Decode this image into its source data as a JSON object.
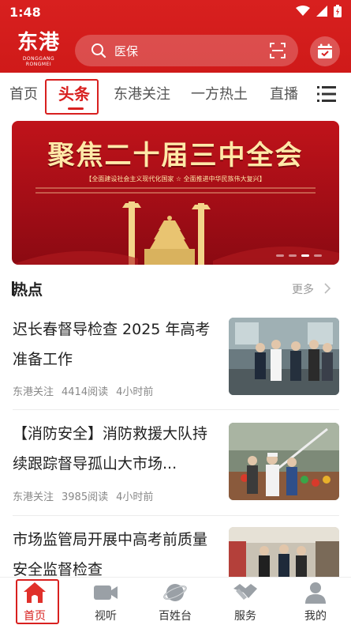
{
  "status": {
    "time": "1:48"
  },
  "header": {
    "logo_main": "东港",
    "logo_sub": "DONGGANG RONGMEI",
    "search_placeholder": "医保",
    "icons": {
      "search": "search-icon",
      "scan": "scan-icon",
      "calendar": "calendar-check-icon"
    }
  },
  "tabs": [
    {
      "label": "首页",
      "active": false
    },
    {
      "label": "头条",
      "active": true
    },
    {
      "label": "东港关注",
      "active": false
    },
    {
      "label": "一方热土",
      "active": false
    },
    {
      "label": "直播",
      "active": false
    }
  ],
  "banner": {
    "title": "聚焦二十届三中全会",
    "subtitle": "【全面建设社会主义现代化国家 ☆ 全面推进中华民族伟大复兴】"
  },
  "section": {
    "title": "热点",
    "more": "更多"
  },
  "news": [
    {
      "title": "迟长春督导检查 2025 年高考准备工作",
      "source": "东港关注",
      "reads": "4414阅读",
      "time": "4小时前"
    },
    {
      "title": "【消防安全】消防救援大队持续跟踪督导孤山大市场...",
      "source": "东港关注",
      "reads": "3985阅读",
      "time": "4小时前"
    },
    {
      "title": "市场监管局开展中高考前质量安全监督检查",
      "source": "",
      "reads": "",
      "time": ""
    }
  ],
  "bottom_nav": [
    {
      "label": "首页",
      "icon": "home-icon",
      "active": true
    },
    {
      "label": "视听",
      "icon": "video-camera-icon",
      "active": false
    },
    {
      "label": "百姓台",
      "icon": "planet-icon",
      "active": false
    },
    {
      "label": "服务",
      "icon": "handshake-icon",
      "active": false
    },
    {
      "label": "我的",
      "icon": "user-icon",
      "active": false
    }
  ],
  "colors": {
    "brand_red": "#d8201f"
  }
}
